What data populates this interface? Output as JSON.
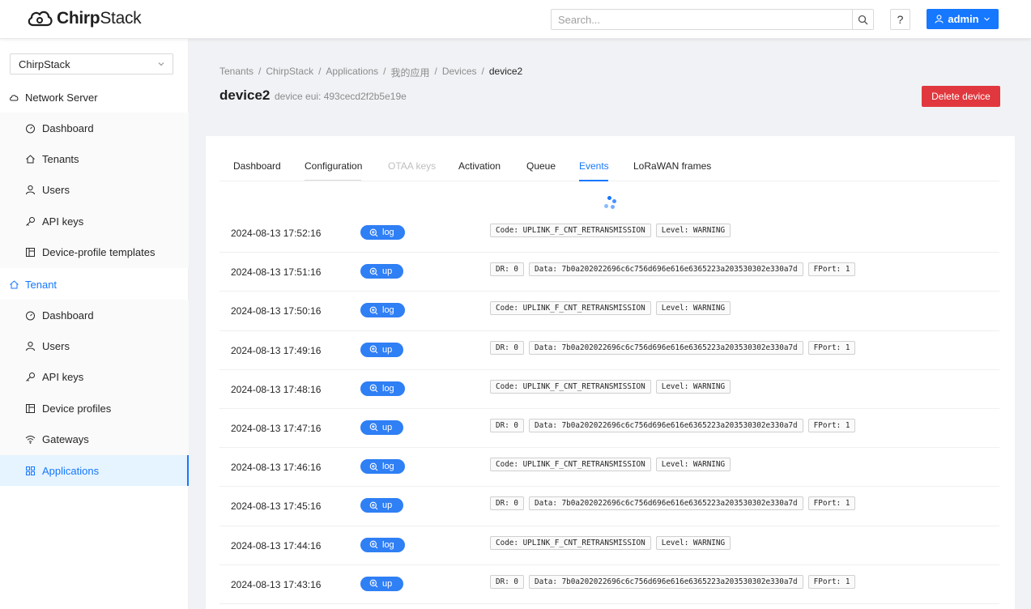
{
  "header": {
    "logo_text_a": "Chirp",
    "logo_text_b": "Stack",
    "search_placeholder": "Search...",
    "help_label": "?",
    "user_label": "admin"
  },
  "sidebar": {
    "tenant_select": "ChirpStack",
    "network_server_label": "Network Server",
    "network_server_items": [
      {
        "label": "Dashboard",
        "icon": "dashboard-icon"
      },
      {
        "label": "Tenants",
        "icon": "home-icon"
      },
      {
        "label": "Users",
        "icon": "user-icon"
      },
      {
        "label": "API keys",
        "icon": "key-icon"
      },
      {
        "label": "Device-profile templates",
        "icon": "template-icon"
      }
    ],
    "tenant_label": "Tenant",
    "tenant_items": [
      {
        "label": "Dashboard",
        "icon": "dashboard-icon"
      },
      {
        "label": "Users",
        "icon": "user-icon"
      },
      {
        "label": "API keys",
        "icon": "key-icon"
      },
      {
        "label": "Device profiles",
        "icon": "template-icon"
      },
      {
        "label": "Gateways",
        "icon": "wifi-icon"
      },
      {
        "label": "Applications",
        "icon": "apps-icon"
      }
    ]
  },
  "breadcrumb": [
    "Tenants",
    "ChirpStack",
    "Applications",
    "我的应用",
    "Devices",
    "device2"
  ],
  "page": {
    "title": "device2",
    "subtitle": "device eui: 493cecd2f2b5e19e",
    "delete_label": "Delete device"
  },
  "tabs": [
    "Dashboard",
    "Configuration",
    "OTAA keys",
    "Activation",
    "Queue",
    "Events",
    "LoRaWAN frames"
  ],
  "events": [
    {
      "time": "2024-08-13 17:52:16",
      "type": "log",
      "chips": [
        "Code: UPLINK_F_CNT_RETRANSMISSION",
        "Level: WARNING"
      ]
    },
    {
      "time": "2024-08-13 17:51:16",
      "type": "up",
      "chips": [
        "DR: 0",
        "Data: 7b0a202022696c6c756d696e616e6365223a203530302e330a7d",
        "FPort: 1"
      ]
    },
    {
      "time": "2024-08-13 17:50:16",
      "type": "log",
      "chips": [
        "Code: UPLINK_F_CNT_RETRANSMISSION",
        "Level: WARNING"
      ]
    },
    {
      "time": "2024-08-13 17:49:16",
      "type": "up",
      "chips": [
        "DR: 0",
        "Data: 7b0a202022696c6c756d696e616e6365223a203530302e330a7d",
        "FPort: 1"
      ]
    },
    {
      "time": "2024-08-13 17:48:16",
      "type": "log",
      "chips": [
        "Code: UPLINK_F_CNT_RETRANSMISSION",
        "Level: WARNING"
      ]
    },
    {
      "time": "2024-08-13 17:47:16",
      "type": "up",
      "chips": [
        "DR: 0",
        "Data: 7b0a202022696c6c756d696e616e6365223a203530302e330a7d",
        "FPort: 1"
      ]
    },
    {
      "time": "2024-08-13 17:46:16",
      "type": "log",
      "chips": [
        "Code: UPLINK_F_CNT_RETRANSMISSION",
        "Level: WARNING"
      ]
    },
    {
      "time": "2024-08-13 17:45:16",
      "type": "up",
      "chips": [
        "DR: 0",
        "Data: 7b0a202022696c6c756d696e616e6365223a203530302e330a7d",
        "FPort: 1"
      ]
    },
    {
      "time": "2024-08-13 17:44:16",
      "type": "log",
      "chips": [
        "Code: UPLINK_F_CNT_RETRANSMISSION",
        "Level: WARNING"
      ]
    },
    {
      "time": "2024-08-13 17:43:16",
      "type": "up",
      "chips": [
        "DR: 0",
        "Data: 7b0a202022696c6c756d696e616e6365223a203530302e330a7d",
        "FPort: 1"
      ]
    }
  ],
  "colors": {
    "accent": "#1677ff",
    "danger": "#e0383e",
    "tag": "#2f7ff5"
  }
}
